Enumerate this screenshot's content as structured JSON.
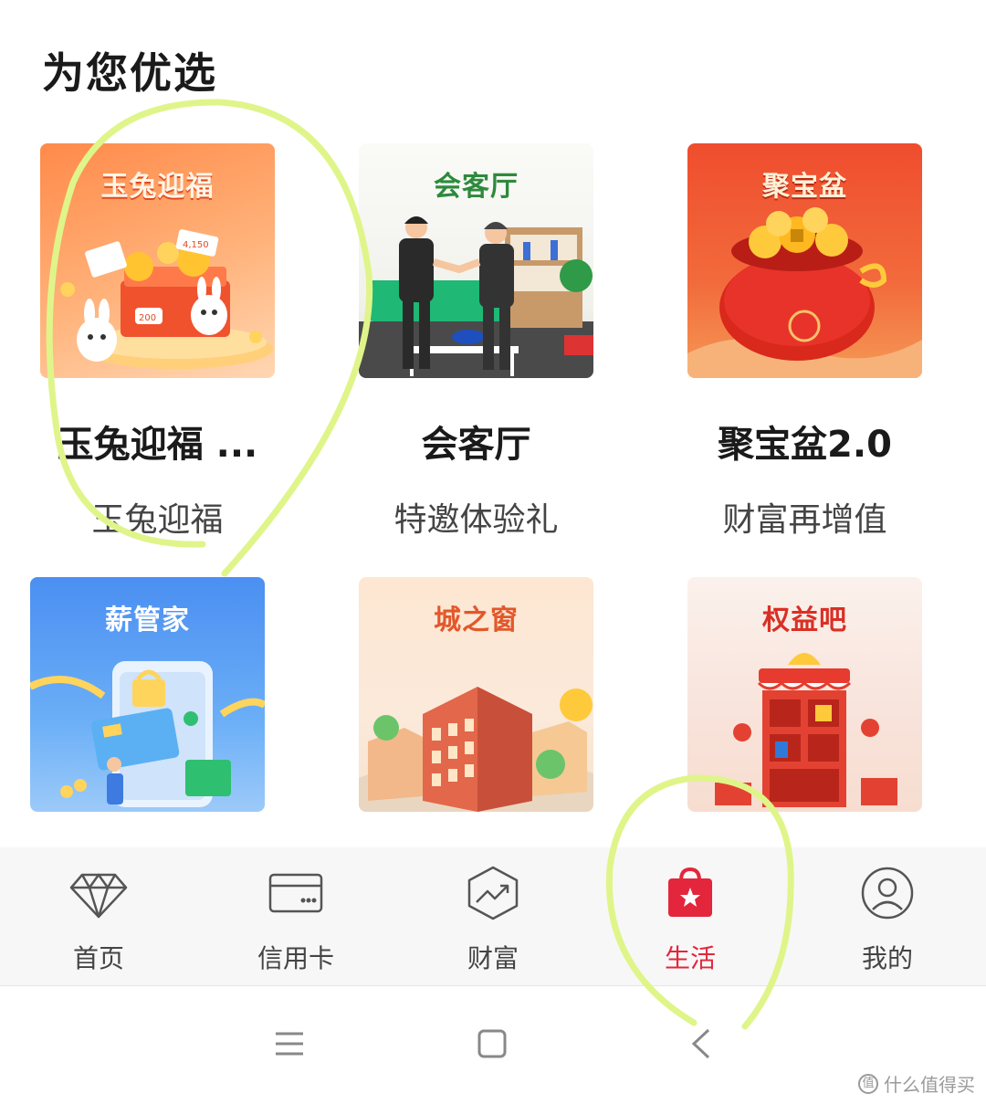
{
  "section": {
    "title": "为您优选"
  },
  "cards": [
    {
      "thumb_title": "玉兔迎福",
      "name": "玉兔迎福 ...",
      "desc": "玉兔迎福"
    },
    {
      "thumb_title": "会客厅",
      "name": "会客厅",
      "desc": "特邀体验礼"
    },
    {
      "thumb_title": "聚宝盆",
      "name": "聚宝盆2.0",
      "desc": "财富再增值"
    },
    {
      "thumb_title": "薪管家"
    },
    {
      "thumb_title": "城之窗"
    },
    {
      "thumb_title": "权益吧"
    }
  ],
  "thumb_texts": {
    "coupon_1": "4,150",
    "coupon_2": "200"
  },
  "tabbar": {
    "items": [
      {
        "label": "首页",
        "icon": "diamond-icon"
      },
      {
        "label": "信用卡",
        "icon": "credit-card-icon"
      },
      {
        "label": "财富",
        "icon": "wealth-chart-icon"
      },
      {
        "label": "生活",
        "icon": "shopping-bag-icon"
      },
      {
        "label": "我的",
        "icon": "user-icon"
      }
    ],
    "active_index": 3
  },
  "system_nav": {
    "buttons": [
      "menu-icon",
      "home-icon",
      "back-icon"
    ]
  },
  "watermark": {
    "badge": "值",
    "text": "什么值得买"
  },
  "colors": {
    "accent": "#e3263b",
    "annotation": "#dff58a",
    "tabbar_bg": "#f7f7f7"
  }
}
